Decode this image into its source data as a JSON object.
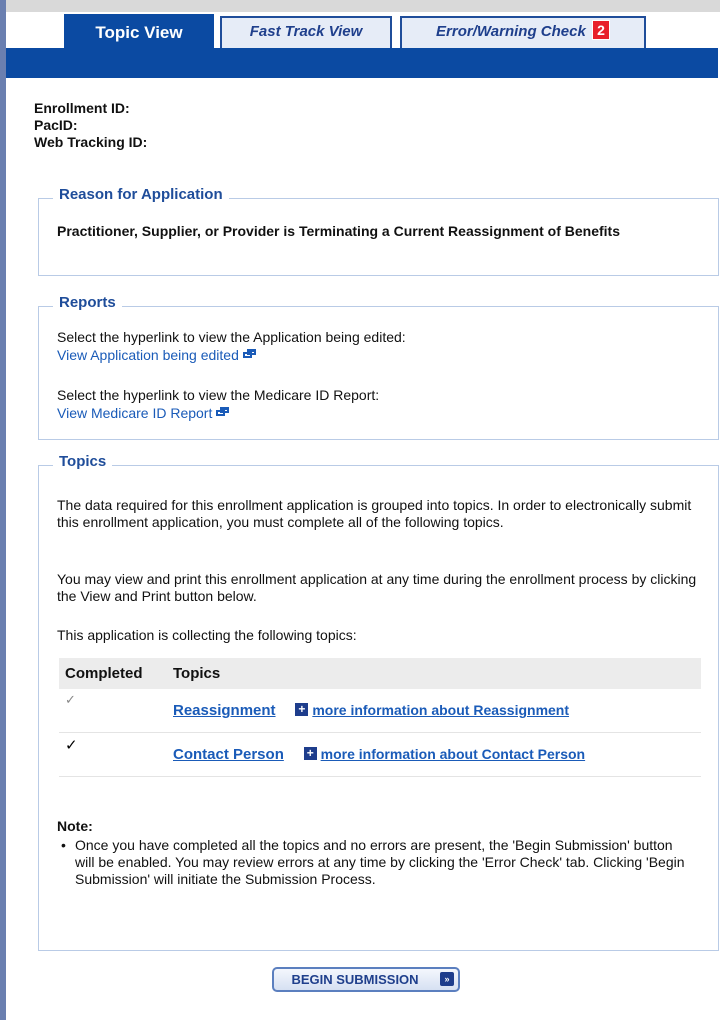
{
  "tabs": {
    "topic_view": "Topic View",
    "fast_track": "Fast Track View",
    "error_check": "Error/Warning Check",
    "error_count": "2"
  },
  "ids": {
    "enrollment": "Enrollment ID:",
    "pac": "PacID:",
    "web_tracking": "Web Tracking ID:"
  },
  "reason": {
    "title": "Reason for Application",
    "text": "Practitioner, Supplier, or Provider is Terminating a Current Reassignment of Benefits"
  },
  "reports": {
    "title": "Reports",
    "app_prompt": "Select the hyperlink to view the Application being edited:",
    "app_link": "View Application being edited",
    "medicare_prompt": "Select the hyperlink to view the Medicare ID Report:",
    "medicare_link": "View Medicare ID Report"
  },
  "topics": {
    "title": "Topics",
    "para1": "The data required for this enrollment application is grouped into topics. In order to electronically submit this enrollment application, you must complete all of the following topics.",
    "para2": "You may view and print this enrollment application at any time during the enrollment process by clicking the View and Print button below.",
    "para3": "This application is collecting the following topics:",
    "col_completed": "Completed",
    "col_topics": "Topics",
    "rows": [
      {
        "completed": "✓",
        "name": "Reassignment",
        "more": "more information about  Reassignment"
      },
      {
        "completed": "✓",
        "name": "Contact Person",
        "more": "more information about  Contact Person"
      }
    ],
    "note_label": "Note:",
    "note_text": "Once you have completed all the topics and no errors are present, the 'Begin Submission' button will be enabled. You may review errors at any time by clicking the 'Error Check' tab. Clicking 'Begin Submission' will initiate the Submission Process."
  },
  "submit": {
    "label": "BEGIN SUBMISSION"
  },
  "colors": {
    "brand_blue": "#0b4aa2",
    "link_blue": "#1a5bb8",
    "badge_red": "#e8202a"
  }
}
